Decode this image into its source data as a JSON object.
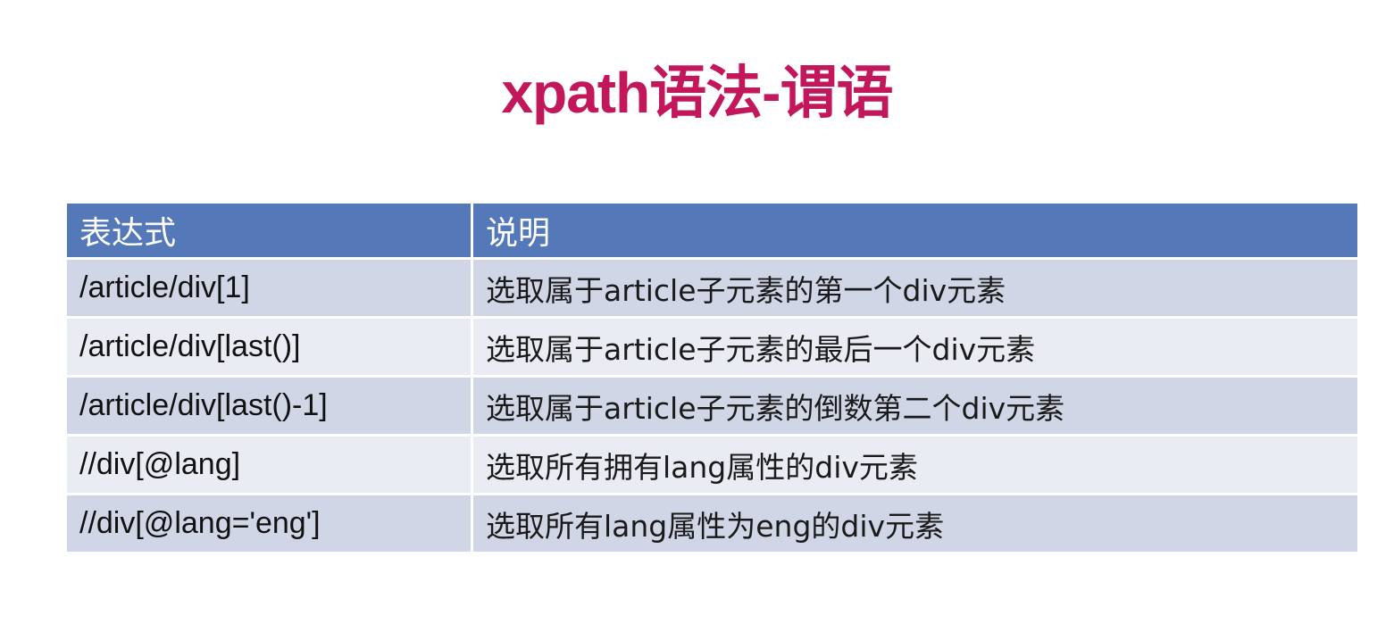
{
  "slide": {
    "title": "xpath语法-谓语"
  },
  "table": {
    "headers": {
      "expression": "表达式",
      "description": "说明"
    },
    "rows": [
      {
        "expression": "/article/div[1]",
        "description": "选取属于article子元素的第一个div元素"
      },
      {
        "expression": "/article/div[last()]",
        "description": "选取属于article子元素的最后一个div元素"
      },
      {
        "expression": "/article/div[last()-1]",
        "description": "选取属于article子元素的倒数第二个div元素"
      },
      {
        "expression": "//div[@lang]",
        "description": "选取所有拥有lang属性的div元素"
      },
      {
        "expression": "//div[@lang='eng']",
        "description": "选取所有lang属性为eng的div元素"
      }
    ]
  },
  "colors": {
    "title": "#c2185b",
    "header_background": "#5579b8",
    "row_background_dark": "#d0d6e6",
    "row_background_light": "#e9ecf3"
  }
}
